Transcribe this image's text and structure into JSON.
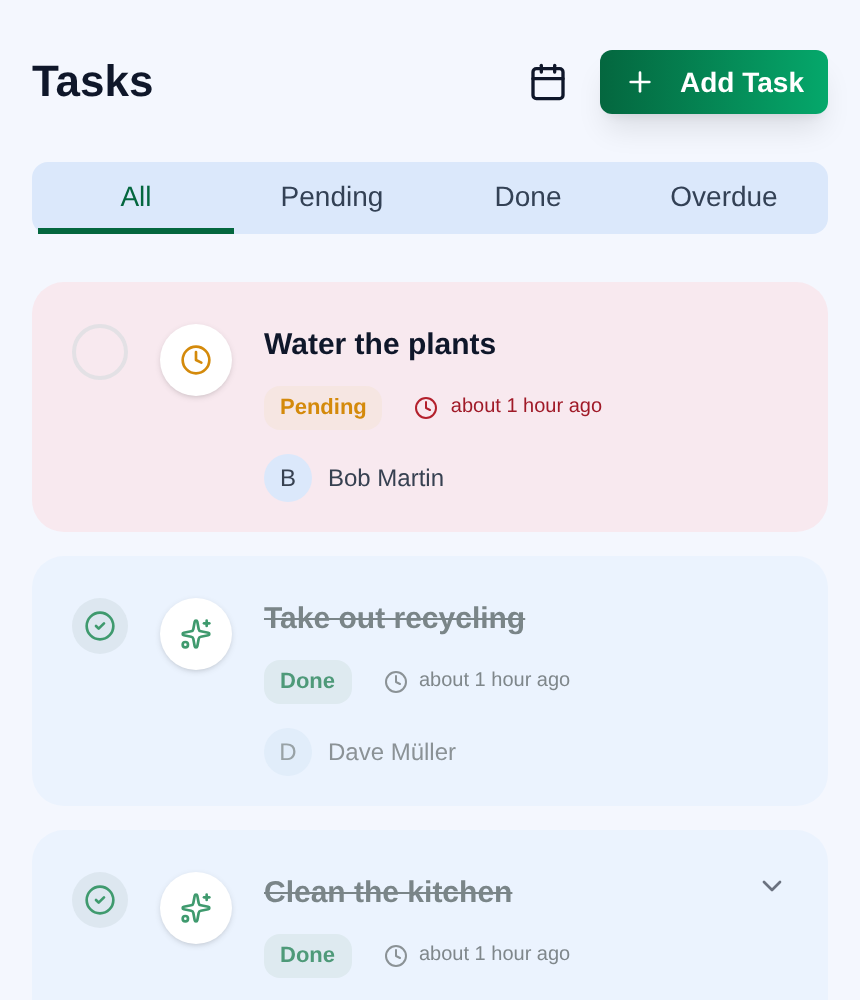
{
  "title": "Tasks",
  "add_button": "Add Task",
  "tabs": [
    {
      "label": "All",
      "selected": true
    },
    {
      "label": "Pending",
      "selected": false
    },
    {
      "label": "Done",
      "selected": false
    },
    {
      "label": "Overdue",
      "selected": false
    }
  ],
  "tasks": [
    {
      "title": "Water the plants",
      "kind": "pending",
      "checked": false,
      "overdue": true,
      "status": "Pending",
      "time": "about 1 hour ago",
      "assignee_initial": "B",
      "assignee": "Bob Martin",
      "has_menu": false
    },
    {
      "title": "Take out recycling",
      "kind": "done",
      "checked": true,
      "overdue": false,
      "status": "Done",
      "time": "about 1 hour ago",
      "assignee_initial": "D",
      "assignee": "Dave Müller",
      "has_menu": false
    },
    {
      "title": "Clean the kitchen",
      "kind": "done",
      "checked": true,
      "overdue": false,
      "status": "Done",
      "time": "about 1 hour ago",
      "has_menu": true
    }
  ]
}
